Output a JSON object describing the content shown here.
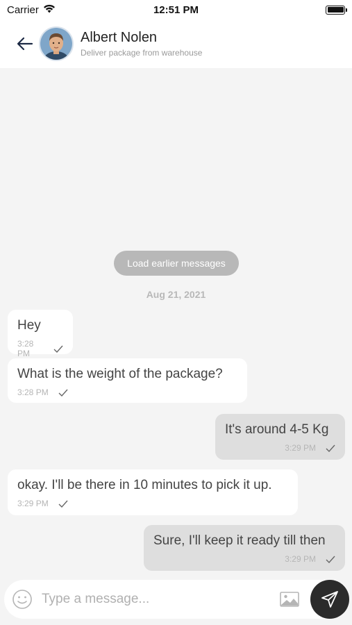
{
  "status_bar": {
    "carrier": "Carrier",
    "time": "12:51 PM"
  },
  "header": {
    "name": "Albert Nolen",
    "subtitle": "Deliver package from warehouse"
  },
  "load_earlier": "Load earlier messages",
  "date_separator": "Aug 21, 2021",
  "messages": [
    {
      "direction": "incoming",
      "text": "Hey",
      "time": "3:28 PM",
      "status": "sent"
    },
    {
      "direction": "incoming",
      "text": "What is the weight of the package?",
      "time": "3:28 PM",
      "status": "sent"
    },
    {
      "direction": "outgoing",
      "text": "It's around 4-5 Kg",
      "time": "3:29 PM",
      "status": "sent"
    },
    {
      "direction": "incoming",
      "text": "okay. I'll be there in 10 minutes to pick it up.",
      "time": "3:29 PM",
      "status": "sent"
    },
    {
      "direction": "outgoing",
      "text": "Sure, I'll keep it ready till then",
      "time": "3:29 PM",
      "status": "sent"
    }
  ],
  "composer": {
    "placeholder": "Type a message...",
    "value": ""
  },
  "icons": {
    "back": "arrow-left-icon",
    "emoji": "smiley-icon",
    "image": "image-icon",
    "send": "send-icon",
    "check": "check-icon",
    "wifi": "wifi-icon",
    "battery": "battery-icon"
  },
  "colors": {
    "incoming_bubble": "#ffffff",
    "outgoing_bubble": "#dedede",
    "background": "#f4f4f4",
    "send_button": "#2b2b2b",
    "load_earlier_pill": "#b8b8b8"
  }
}
